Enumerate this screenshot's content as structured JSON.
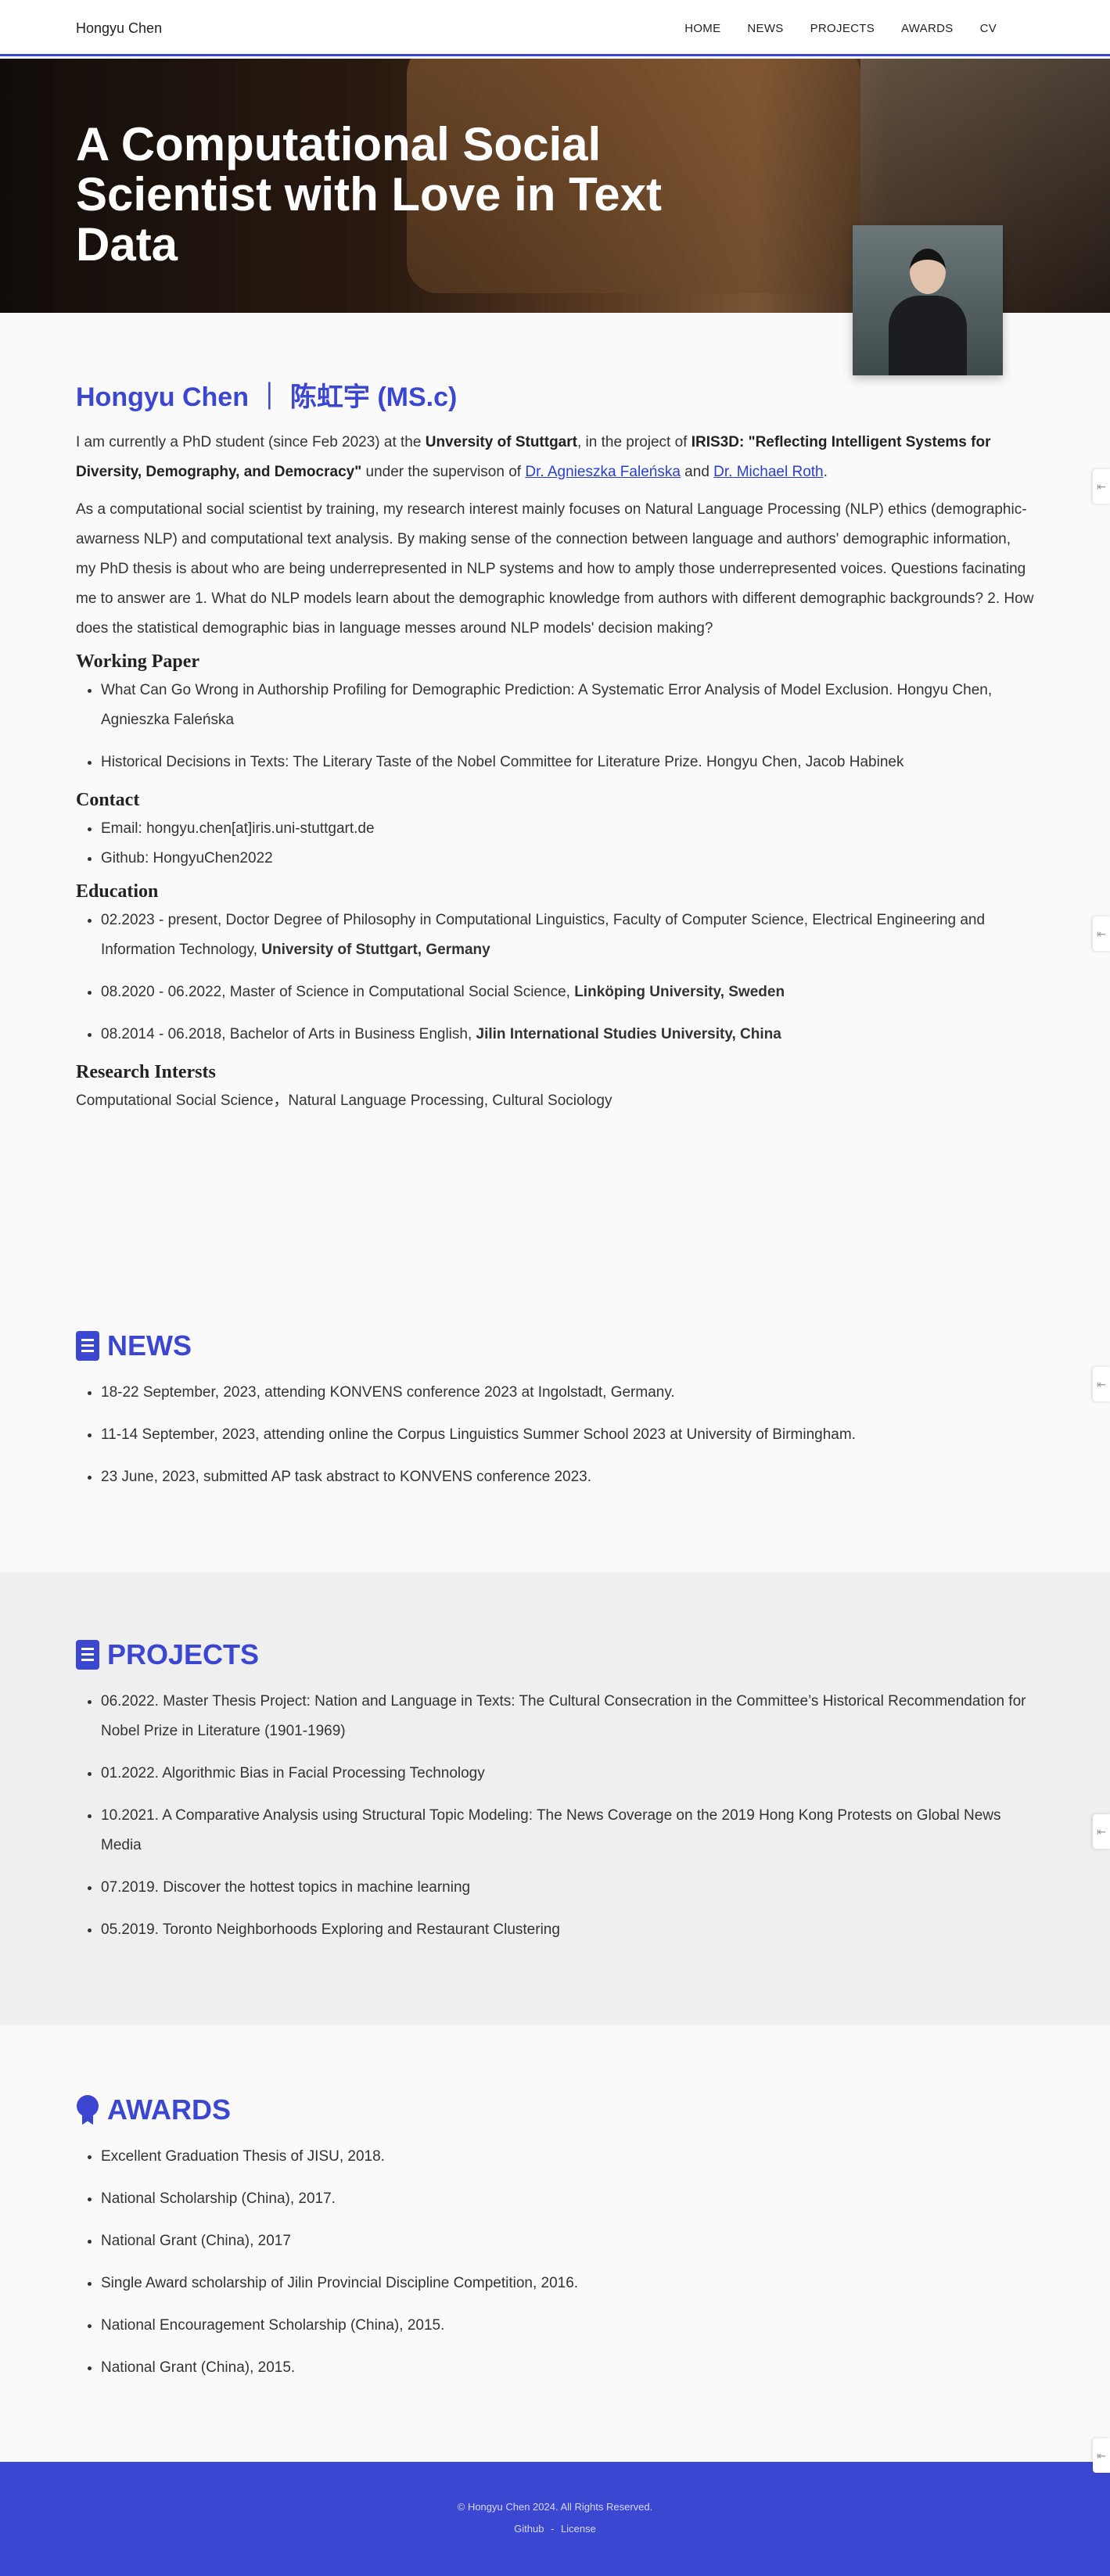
{
  "nav": {
    "brand": "Hongyu Chen",
    "items": [
      "HOME",
      "NEWS",
      "PROJECTS",
      "AWARDS",
      "CV"
    ]
  },
  "hero": {
    "title": "A Computational Social Scientist with Love in Text Data"
  },
  "about": {
    "name": "Hongyu Chen ｜ 陈虹宇 (MS.c)",
    "p1": {
      "t1": "I am currently a PhD student (since Feb 2023) at the ",
      "b1": "Unversity of Stuttgart",
      "t2": ", in the project of ",
      "b2": "IRIS3D: \"Reflecting Intelligent Systems for Diversity, Demography, and Democracy\"",
      "t3": " under the supervison of ",
      "l1": "Dr. Agnieszka Faleńska",
      "t4": " and ",
      "l2": "Dr. Michael Roth",
      "t5": "."
    },
    "p2": "As a computational social scientist by training, my research interest mainly focuses on Natural Language Processing (NLP) ethics (demographic-awarness NLP) and computational text analysis. By making sense of the connection between language and authors' demographic information, my PhD thesis is about who are being underrepresented in NLP systems and how to amply those underrepresented voices. Questions facinating me to answer are 1. What do NLP models learn about the demographic knowledge from authors with different demographic backgrounds? 2. How does the statistical demographic bias in language messes around NLP models' decision making?",
    "working_paper_title": "Working Paper",
    "working_papers": [
      "What Can Go Wrong in Authorship Profiling for Demographic Prediction: A Systematic Error Analysis of Model Exclusion. Hongyu Chen, Agnieszka Faleńska",
      "Historical Decisions in Texts: The Literary Taste of the Nobel Committee for Literature Prize. Hongyu Chen, Jacob Habinek"
    ],
    "contact_title": "Contact",
    "contact": [
      "Email: hongyu.chen[at]iris.uni-stuttgart.de",
      "Github: HongyuChen2022"
    ],
    "education_title": "Education",
    "education": [
      {
        "text": "02.2023 - present, Doctor Degree of Philosophy in Computational Linguistics, Faculty of Computer Science, Electrical Engineering and Information Technology, ",
        "bold": "University of Stuttgart, Germany"
      },
      {
        "text": "08.2020 - 06.2022, Master of Science in Computational Social Science, ",
        "bold": "Linköping University, Sweden"
      },
      {
        "text": "08.2014 - 06.2018, Bachelor of Arts in Business English, ",
        "bold": "Jilin International Studies University, China"
      }
    ],
    "interests_title": "Research Intersts",
    "interests": "Computational Social Science，Natural Language Processing, Cultural Sociology"
  },
  "news": {
    "title": "NEWS",
    "icon": "document-icon",
    "items": [
      "18-22 September, 2023, attending KONVENS conference 2023 at Ingolstadt, Germany.",
      "11-14 September, 2023, attending online the Corpus Linguistics Summer School 2023 at University of Birmingham.",
      "23 June, 2023, submitted AP task abstract to KONVENS conference 2023."
    ]
  },
  "projects": {
    "title": "PROJECTS",
    "icon": "document-icon",
    "items": [
      "06.2022. Master Thesis Project: Nation and Language in Texts: The Cultural Consecration in the Committee’s Historical Recommendation for Nobel Prize in Literature (1901-1969)",
      "01.2022. Algorithmic Bias in Facial Processing Technology",
      "10.2021. A Comparative Analysis using Structural Topic Modeling: The News Coverage on the 2019 Hong Kong Protests on Global News Media",
      "07.2019. Discover the hottest topics in machine learning",
      "05.2019. Toronto Neighborhoods Exploring and Restaurant Clustering"
    ]
  },
  "awards": {
    "title": "AWARDS",
    "icon": "award-icon",
    "items": [
      "Excellent Graduation Thesis of JISU, 2018.",
      "National Scholarship (China), 2017.",
      "National Grant (China), 2017",
      "Single Award scholarship of Jilin Provincial Discipline Competition, 2016.",
      "National Encouragement Scholarship (China), 2015.",
      "National Grant (China), 2015."
    ]
  },
  "footer": {
    "copyright": "© Hongyu Chen 2024. All Rights Reserved.",
    "link1": "Github",
    "sep": "-",
    "link2": "License"
  },
  "colors": {
    "accent": "#3b47d1"
  }
}
